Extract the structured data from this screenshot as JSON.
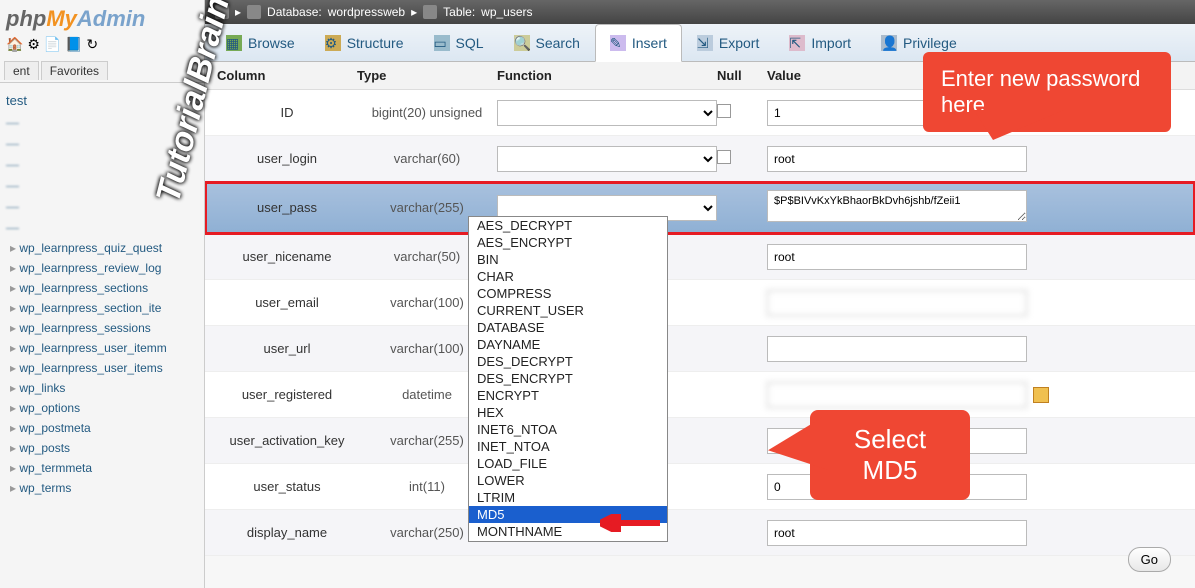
{
  "logo": {
    "php": "php",
    "my": "My",
    "admin": "Admin"
  },
  "sidetabs": {
    "recent": "ent",
    "favorites": "Favorites"
  },
  "db_name": "test",
  "tables": [
    "wp_learnpress_quiz_quest",
    "wp_learnpress_review_log",
    "wp_learnpress_sections",
    "wp_learnpress_section_ite",
    "wp_learnpress_sessions",
    "wp_learnpress_user_itemm",
    "wp_learnpress_user_items",
    "wp_links",
    "wp_options",
    "wp_postmeta",
    "wp_posts",
    "wp_termmeta",
    "wp_terms"
  ],
  "breadcrumb": {
    "db_label": "Database:",
    "db": "wordpressweb",
    "tbl_label": "Table:",
    "tbl": "wp_users"
  },
  "nav": {
    "browse": "Browse",
    "structure": "Structure",
    "sql": "SQL",
    "search": "Search",
    "insert": "Insert",
    "export": "Export",
    "import": "Import",
    "privileges": "Privilege"
  },
  "headers": {
    "column": "Column",
    "type": "Type",
    "function": "Function",
    "null": "Null",
    "value": "Value"
  },
  "rows": [
    {
      "name": "ID",
      "type": "bigint(20) unsigned",
      "value": "1",
      "alt": false
    },
    {
      "name": "user_login",
      "type": "varchar(60)",
      "value": "root",
      "alt": true
    },
    {
      "name": "user_pass",
      "type": "varchar(255)",
      "value": "$P$BIVvKxYkBhaorBkDvh6jshb/fZeii1",
      "alt": false,
      "highlight": true,
      "textarea": true
    },
    {
      "name": "user_nicename",
      "type": "varchar(50)",
      "value": "root",
      "alt": true
    },
    {
      "name": "user_email",
      "type": "varchar(100)",
      "value": "",
      "alt": false,
      "blur": true
    },
    {
      "name": "user_url",
      "type": "varchar(100)",
      "value": "",
      "alt": true
    },
    {
      "name": "user_registered",
      "type": "datetime",
      "value": "",
      "alt": false,
      "blur": true,
      "cal": true
    },
    {
      "name": "user_activation_key",
      "type": "varchar(255)",
      "value": "",
      "alt": true
    },
    {
      "name": "user_status",
      "type": "int(11)",
      "value": "0",
      "alt": false
    },
    {
      "name": "display_name",
      "type": "varchar(250)",
      "value": "root",
      "alt": true
    }
  ],
  "dropdown": [
    "AES_DECRYPT",
    "AES_ENCRYPT",
    "BIN",
    "CHAR",
    "COMPRESS",
    "CURRENT_USER",
    "DATABASE",
    "DAYNAME",
    "DES_DECRYPT",
    "DES_ENCRYPT",
    "ENCRYPT",
    "HEX",
    "INET6_NTOA",
    "INET_NTOA",
    "LOAD_FILE",
    "LOWER",
    "LTRIM",
    "MD5",
    "MONTHNAME"
  ],
  "dropdown_selected": "MD5",
  "go": "Go",
  "callout1": "Enter new password here",
  "callout2_line1": "Select",
  "callout2_line2": "MD5",
  "watermark": "TutorialBrain"
}
